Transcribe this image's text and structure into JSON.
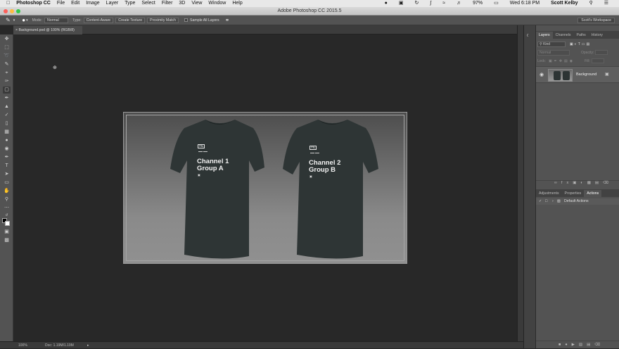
{
  "menubar": {
    "apple": "",
    "items": [
      "Photoshop CC",
      "File",
      "Edit",
      "Image",
      "Layer",
      "Type",
      "Select",
      "Filter",
      "3D",
      "View",
      "Window",
      "Help"
    ],
    "battery": "97%",
    "datetime": "Wed 6:18 PM",
    "user": "Scott Kelby"
  },
  "window": {
    "title": "Adobe Photoshop CC 2015.5"
  },
  "options": {
    "brush_size": "",
    "mode_label": "Mode:",
    "mode_value": "Normal",
    "type_label": "Type:",
    "type_buttons": [
      "Content-Aware",
      "Create Texture",
      "Proximity Match"
    ],
    "sample_all_layers": "Sample All Layers",
    "workspace": "Scott's Workspace"
  },
  "document_tab": {
    "title": "Background.psd @ 100% (RGB/8)"
  },
  "status": {
    "zoom": "100%",
    "doc": "Doc: 1.19M/1.19M"
  },
  "artwork": {
    "shirt1": {
      "logo": "TTL",
      "line1": "Channel 1",
      "line2": "Group A",
      "shirt_color": "#2e3535"
    },
    "shirt2": {
      "logo": "TTL",
      "line1": "Channel 2",
      "line2": "Group B",
      "shirt_color": "#2e3535"
    }
  },
  "layers_panel": {
    "tabs": [
      "Layers",
      "Channels",
      "Paths",
      "History"
    ],
    "kind": "Kind",
    "blend_mode": "Normal",
    "opacity_label": "Opacity:",
    "lock_label": "Lock:",
    "fill_label": "Fill:",
    "layer_name": "Background"
  },
  "actions_panel": {
    "tabs": [
      "Adjustments",
      "Properties",
      "Actions"
    ],
    "item": "Default Actions"
  }
}
